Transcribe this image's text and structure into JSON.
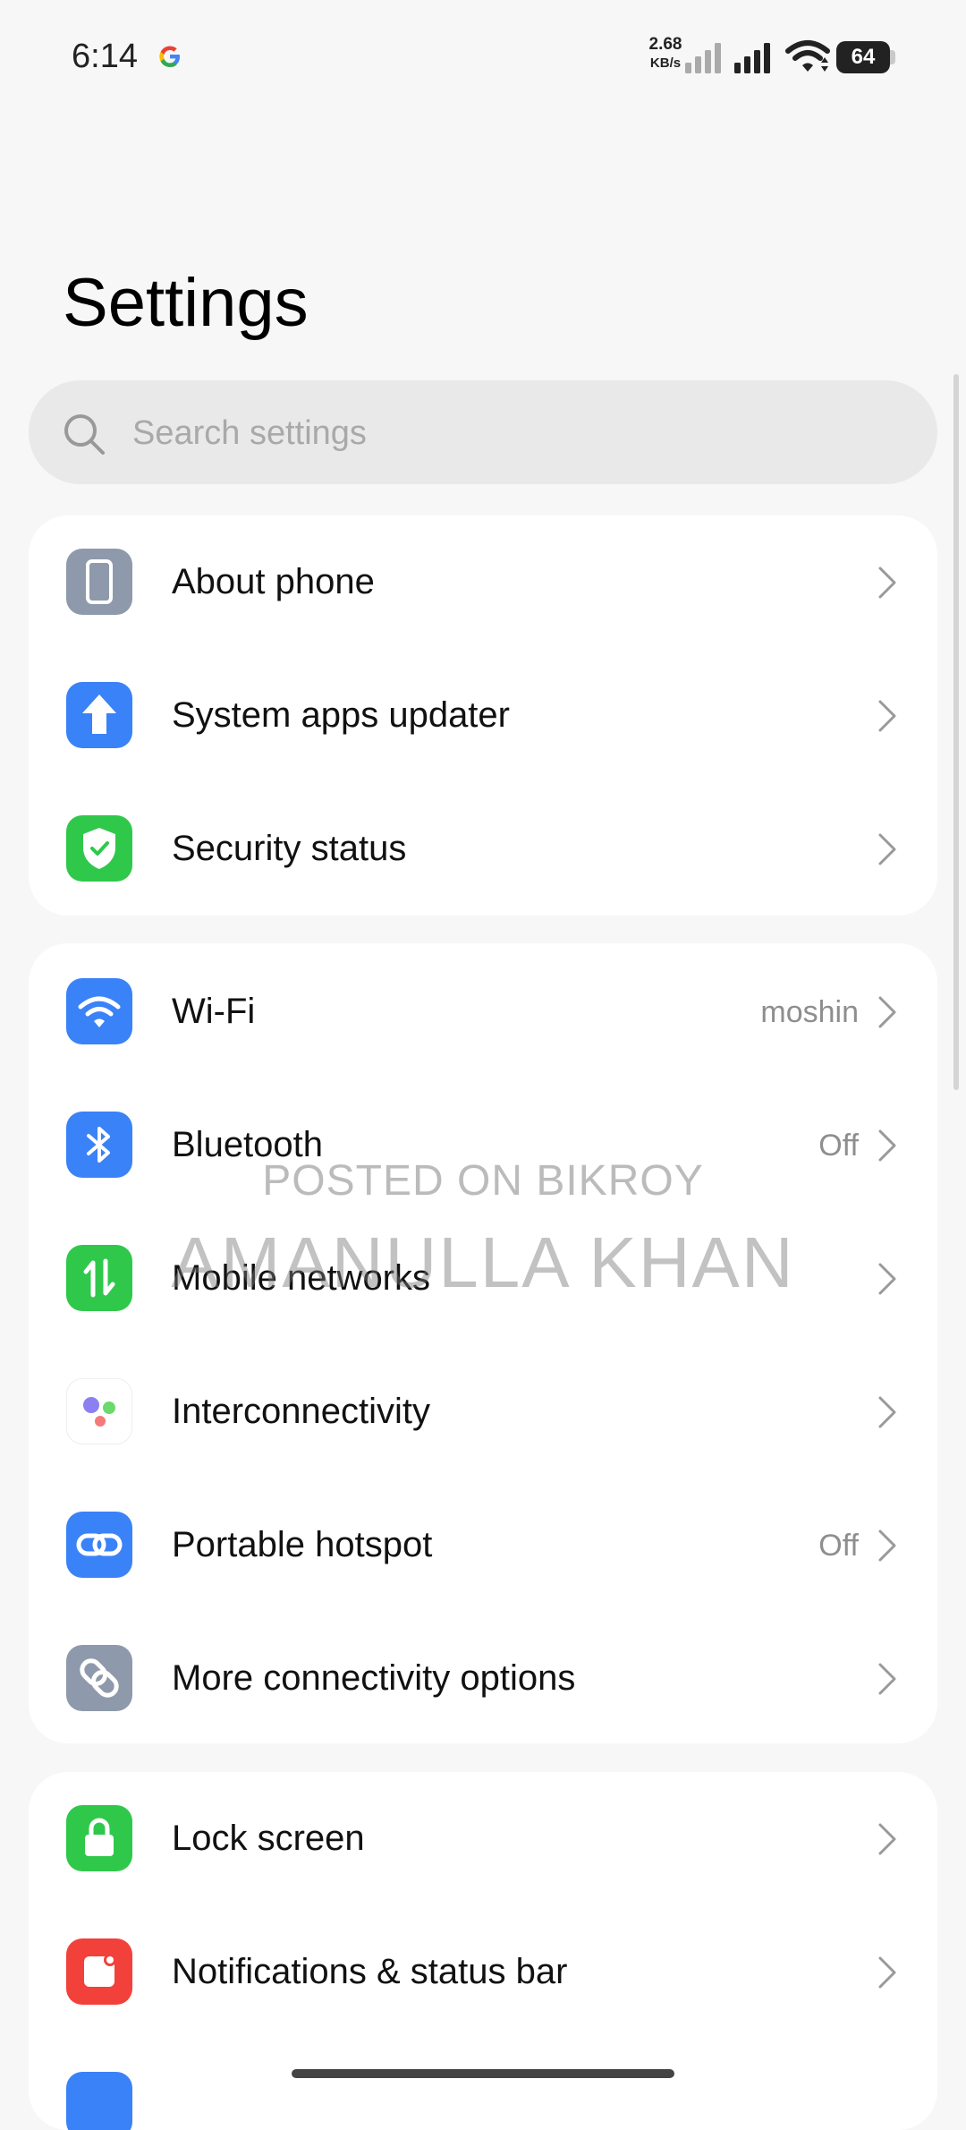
{
  "status_bar": {
    "time": "6:14",
    "net_speed_value": "2.68",
    "net_speed_unit": "KB/s",
    "battery": "64"
  },
  "title": "Settings",
  "search": {
    "placeholder": "Search settings"
  },
  "groups": [
    {
      "items": [
        {
          "label": "About phone",
          "value": "",
          "icon": "phone-icon",
          "color": "#8e9aab"
        },
        {
          "label": "System apps updater",
          "value": "",
          "icon": "arrow-up-icon",
          "color": "#3a82f7"
        },
        {
          "label": "Security status",
          "value": "",
          "icon": "shield-check-icon",
          "color": "#2fc84b"
        }
      ]
    },
    {
      "items": [
        {
          "label": "Wi-Fi",
          "value": "moshin",
          "icon": "wifi-icon",
          "color": "#3a82f7"
        },
        {
          "label": "Bluetooth",
          "value": "Off",
          "icon": "bluetooth-icon",
          "color": "#3a82f7"
        },
        {
          "label": "Mobile networks",
          "value": "",
          "icon": "mobile-data-icon",
          "color": "#2fc84b"
        },
        {
          "label": "Interconnectivity",
          "value": "",
          "icon": "dots-icon",
          "color": "#ffffff"
        },
        {
          "label": "Portable hotspot",
          "value": "Off",
          "icon": "hotspot-icon",
          "color": "#3a82f7"
        },
        {
          "label": "More connectivity options",
          "value": "",
          "icon": "link-icon",
          "color": "#8e9aab"
        }
      ]
    },
    {
      "items": [
        {
          "label": "Lock screen",
          "value": "",
          "icon": "lock-icon",
          "color": "#2fc84b"
        },
        {
          "label": "Notifications & status bar",
          "value": "",
          "icon": "notification-icon",
          "color": "#f2413b"
        }
      ]
    }
  ],
  "watermark": {
    "line1": "POSTED ON BIKROY",
    "line2": "AMANULLA KHAN"
  }
}
